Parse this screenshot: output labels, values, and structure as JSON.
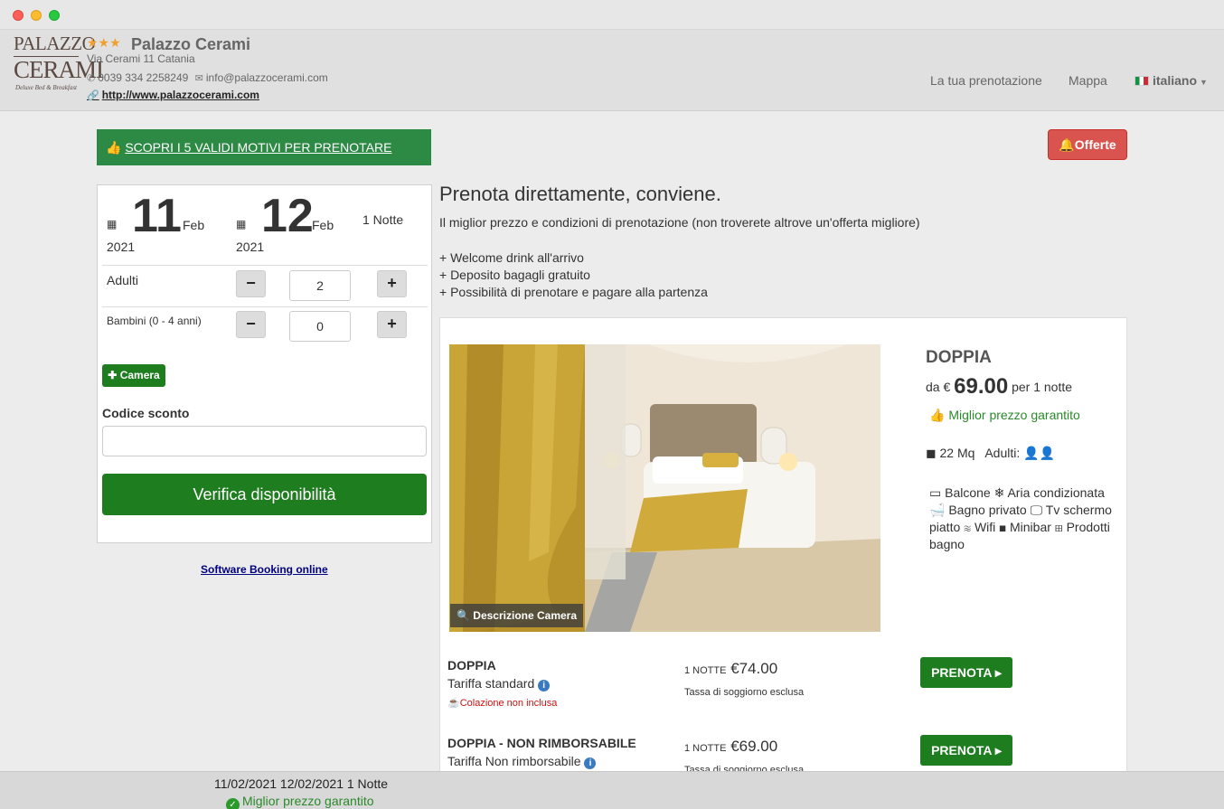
{
  "header": {
    "logo": {
      "line1": "PALAZZO",
      "line2": "CERAMI",
      "line3": "Deluxe Bed & Breakfast"
    },
    "stars": "★★★",
    "hotel_name": "Palazzo Cerami",
    "address": "Via Cerami 11 Catania",
    "phone": "0039 334 2258249",
    "email": "info@palazzocerami.com",
    "website": "http://www.palazzocerami.com",
    "nav": {
      "booking": "La tua prenotazione",
      "map": "Mappa",
      "language": "italiano"
    }
  },
  "promo_banner": "SCOPRI I 5 VALIDI MOTIVI PER PRENOTARE",
  "offers_button": "Offerte",
  "booking_form": {
    "checkin": {
      "day": "11",
      "month": "Feb",
      "year": "2021"
    },
    "checkout": {
      "day": "12",
      "month": "Feb",
      "year": "2021"
    },
    "nights": "1 Notte",
    "adults_label": "Adulti",
    "adults_value": "2",
    "children_label": "Bambini (0 - 4 anni)",
    "children_value": "0",
    "minus": "−",
    "plus": "+",
    "add_room": "Camera",
    "discount_label": "Codice sconto",
    "discount_value": "",
    "verify_button": "Verifica disponibilità"
  },
  "software_link": "Software Booking online",
  "main": {
    "title": "Prenota direttamente, conviene.",
    "subtitle": "Il miglior prezzo e condizioni di prenotazione (non troverete altrove un'offerta migliore)",
    "perks": [
      "+ Welcome drink all'arrivo",
      "+ Deposito bagagli gratuito",
      "+ Possibilità di prenotare e pagare alla partenza"
    ]
  },
  "room": {
    "image_badge": "Descrizione Camera",
    "name": "DOPPIA",
    "price_prefix": "da €",
    "price": "69.00",
    "price_suffix": "per 1 notte",
    "best_price": "Miglior prezzo garantito",
    "size": "22 Mq",
    "adults_label": "Adulti:",
    "amenities": "Balcone ❄ Aria condizionata Bagno privato Tv schermo piatto Wifi Minibar Prodotti bagno",
    "amenity_list": {
      "balcone": "Balcone",
      "aria": "Aria condizionata",
      "bagno": "Bagno privato",
      "tv": "Tv schermo piatto",
      "wifi": "Wifi",
      "minibar": "Minibar",
      "prodotti": "Prodotti bagno"
    }
  },
  "rates": [
    {
      "name": "DOPPIA",
      "type": "Tariffa standard",
      "breakfast": "Colazione non inclusa",
      "nights_prefix": "1 NOTTE",
      "price": "€74.00",
      "tax": "Tassa di soggiorno esclusa",
      "button": "PRENOTA"
    },
    {
      "name": "DOPPIA - NON RIMBORSABILE",
      "type": "Tariffa Non rimborsabile",
      "nights_prefix": "1 NOTTE",
      "price": "€69.00",
      "tax": "Tassa di soggiorno esclusa",
      "button": "PRENOTA"
    }
  ],
  "footer": {
    "dates": "11/02/2021  12/02/2021 1 Notte",
    "best_price": "Miglior prezzo garantito"
  },
  "colors": {
    "green": "#1e7d1e",
    "promo_green": "#2d8a45",
    "red": "#d9534f",
    "link_blue": "#000080"
  }
}
